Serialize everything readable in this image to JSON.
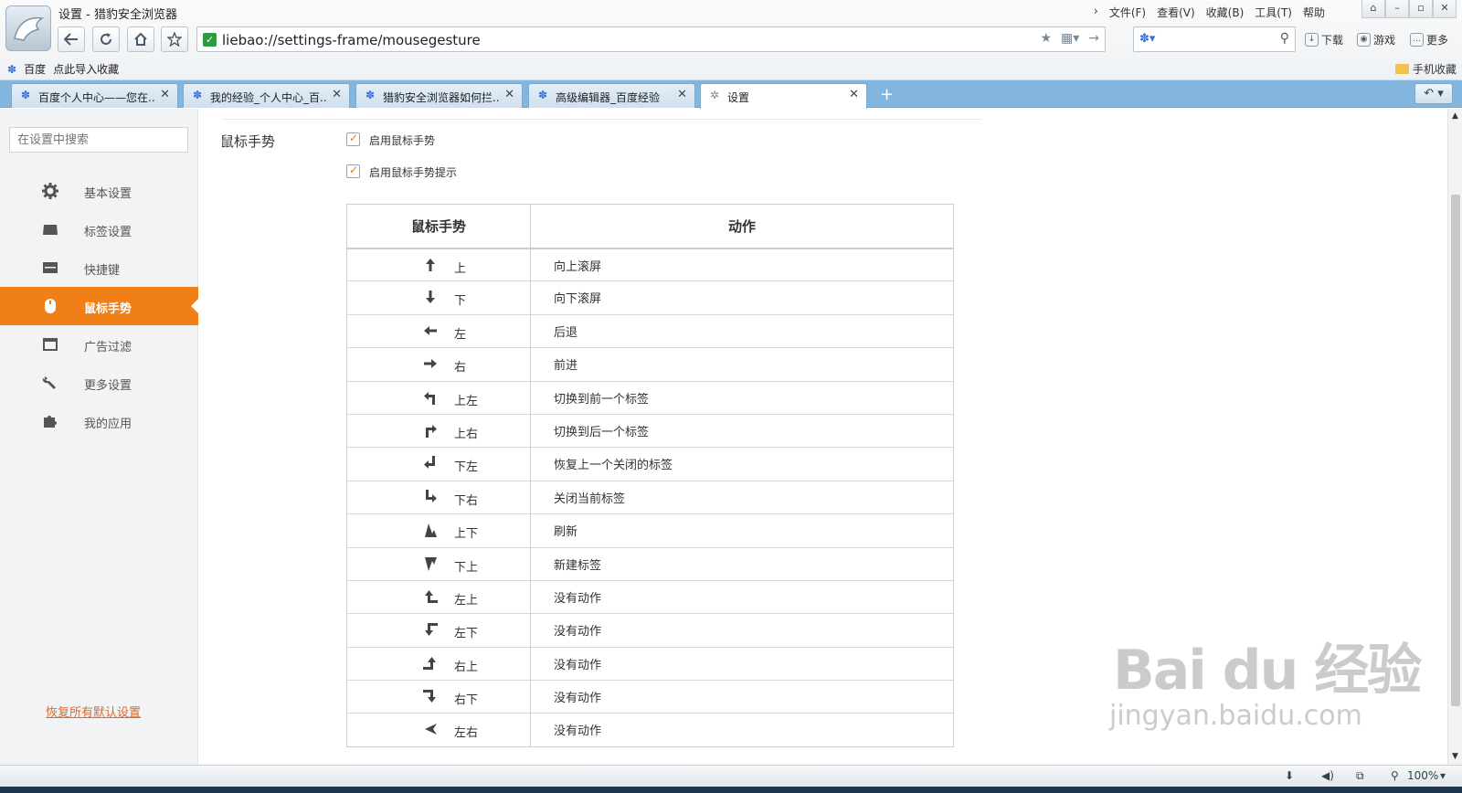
{
  "window": {
    "title": "设置 - 猎豹安全浏览器",
    "menus": [
      "文件(F)",
      "查看(V)",
      "收藏(B)",
      "工具(T)",
      "帮助"
    ],
    "window_buttons": [
      "⌂",
      "–",
      "▫",
      "✕"
    ]
  },
  "toolbar": {
    "url": "liebao://settings-frame/mousegesture",
    "download_label": "下载",
    "games_label": "游戏",
    "more_label": "更多"
  },
  "bookmarks": {
    "items": [
      "百度",
      "点此导入收藏"
    ],
    "mobile_fav": "手机收藏"
  },
  "tabs": [
    {
      "label": "百度个人中心——您在...",
      "active": false
    },
    {
      "label": "我的经验_个人中心_百...",
      "active": false
    },
    {
      "label": "猎豹安全浏览器如何拦...",
      "active": false
    },
    {
      "label": "高级编辑器_百度经验",
      "active": false
    },
    {
      "label": "设置",
      "active": true
    }
  ],
  "sidebar": {
    "search_placeholder": "在设置中搜索",
    "items": [
      {
        "label": "基本设置",
        "icon": "gear-icon",
        "active": false
      },
      {
        "label": "标签设置",
        "icon": "tab-icon",
        "active": false
      },
      {
        "label": "快捷键",
        "icon": "keyboard-icon",
        "active": false
      },
      {
        "label": "鼠标手势",
        "icon": "mouse-icon",
        "active": true
      },
      {
        "label": "广告过滤",
        "icon": "window-icon",
        "active": false
      },
      {
        "label": "更多设置",
        "icon": "wrench-icon",
        "active": false
      },
      {
        "label": "我的应用",
        "icon": "puzzle-icon",
        "active": false
      }
    ],
    "restore_defaults": "恢复所有默认设置"
  },
  "main": {
    "section_title": "鼠标手势",
    "options": [
      {
        "label": "启用鼠标手势",
        "checked": true
      },
      {
        "label": "启用鼠标手势提示",
        "checked": true
      }
    ],
    "table": {
      "headers": [
        "鼠标手势",
        "动作"
      ],
      "rows": [
        {
          "gesture": "上",
          "icon": "arrow-up-icon",
          "action": "向上滚屏"
        },
        {
          "gesture": "下",
          "icon": "arrow-down-icon",
          "action": "向下滚屏"
        },
        {
          "gesture": "左",
          "icon": "arrow-left-icon",
          "action": "后退"
        },
        {
          "gesture": "右",
          "icon": "arrow-right-icon",
          "action": "前进"
        },
        {
          "gesture": "上左",
          "icon": "arrow-up-left-icon",
          "action": "切换到前一个标签"
        },
        {
          "gesture": "上右",
          "icon": "arrow-up-right-icon",
          "action": "切换到后一个标签"
        },
        {
          "gesture": "下左",
          "icon": "arrow-down-left-icon",
          "action": "恢复上一个关闭的标签"
        },
        {
          "gesture": "下右",
          "icon": "arrow-down-right-icon",
          "action": "关闭当前标签"
        },
        {
          "gesture": "上下",
          "icon": "arrow-up-down-icon",
          "action": "刷新"
        },
        {
          "gesture": "下上",
          "icon": "arrow-down-up-icon",
          "action": "新建标签"
        },
        {
          "gesture": "左上",
          "icon": "arrow-left-up-icon",
          "action": "没有动作"
        },
        {
          "gesture": "左下",
          "icon": "arrow-left-down-icon",
          "action": "没有动作"
        },
        {
          "gesture": "右上",
          "icon": "arrow-right-up-icon",
          "action": "没有动作"
        },
        {
          "gesture": "右下",
          "icon": "arrow-right-down-icon",
          "action": "没有动作"
        },
        {
          "gesture": "左右",
          "icon": "arrow-left-right-icon",
          "action": "没有动作"
        }
      ]
    }
  },
  "statusbar": {
    "zoom": "100%"
  },
  "watermark": {
    "main": "Bai du 经验",
    "sub": "jingyan.baidu.com"
  },
  "colors": {
    "accent": "#f07f16",
    "tabbar": "#82b6de",
    "link": "#e0692a"
  }
}
